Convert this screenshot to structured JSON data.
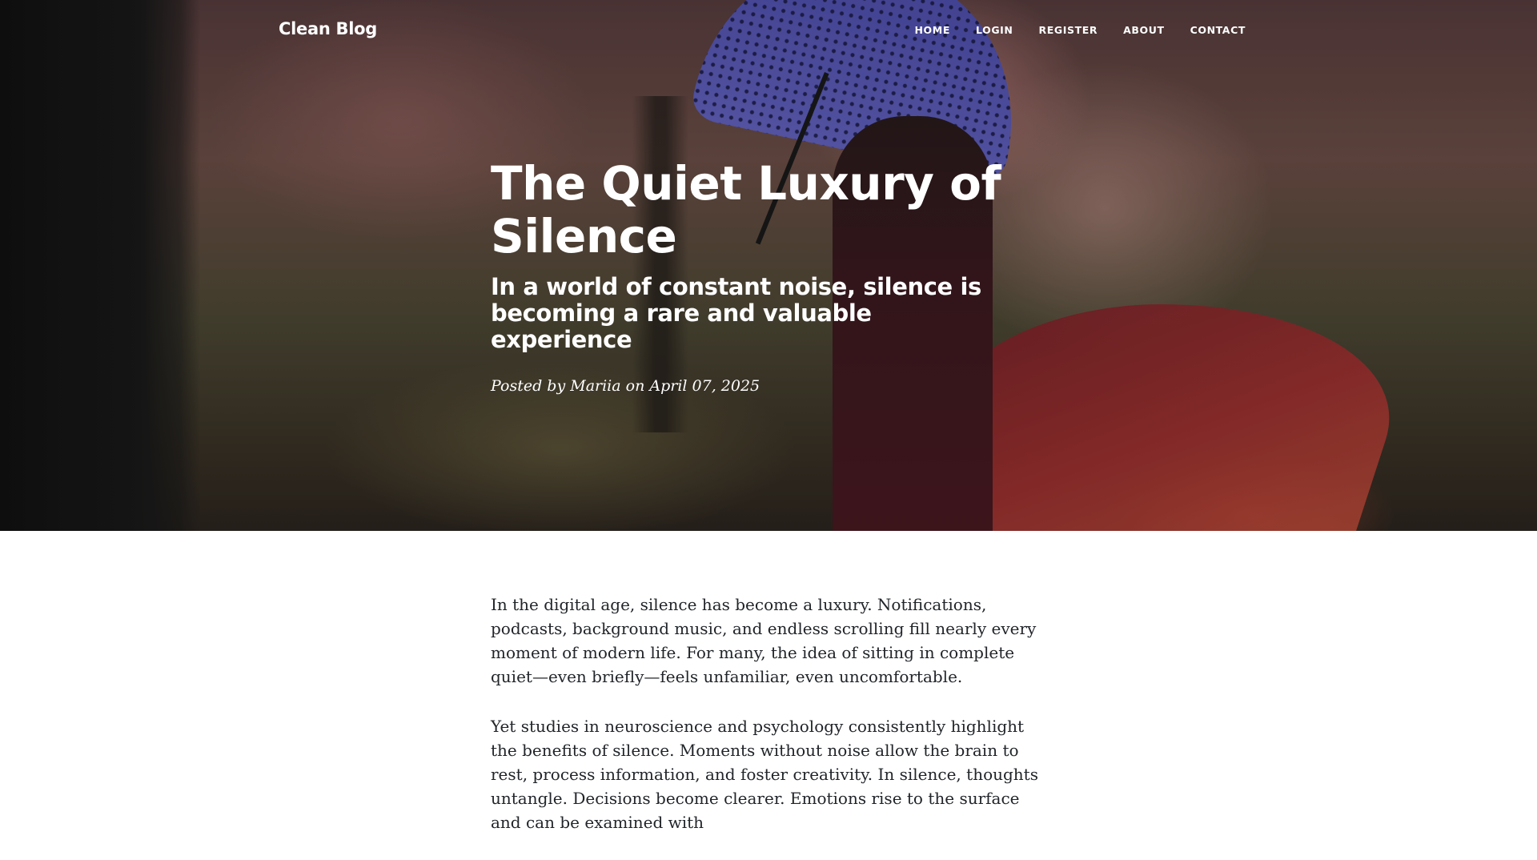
{
  "navbar": {
    "brand": "Clean Blog",
    "links": [
      "HOME",
      "LOGIN",
      "REGISTER",
      "ABOUT",
      "CONTACT"
    ]
  },
  "post": {
    "title": "The Quiet Luxury of Silence",
    "subtitle": "In a world of constant noise, silence is becoming a rare and valuable experience",
    "meta_prefix": "Posted by",
    "author": "Mariia",
    "meta_on": "on",
    "date": "April 07, 2025"
  },
  "article": {
    "paragraphs": [
      "In the digital age, silence has become a luxury. Notifications, podcasts, background music, and endless scrolling fill nearly every moment of modern life. For many, the idea of sitting in complete quiet—even briefly—feels unfamiliar, even uncomfortable.",
      "Yet studies in neuroscience and psychology consistently highlight the benefits of silence. Moments without noise allow the brain to rest, process information, and foster creativity. In silence, thoughts untangle. Decisions become clearer. Emotions rise to the surface and can be examined with"
    ]
  }
}
